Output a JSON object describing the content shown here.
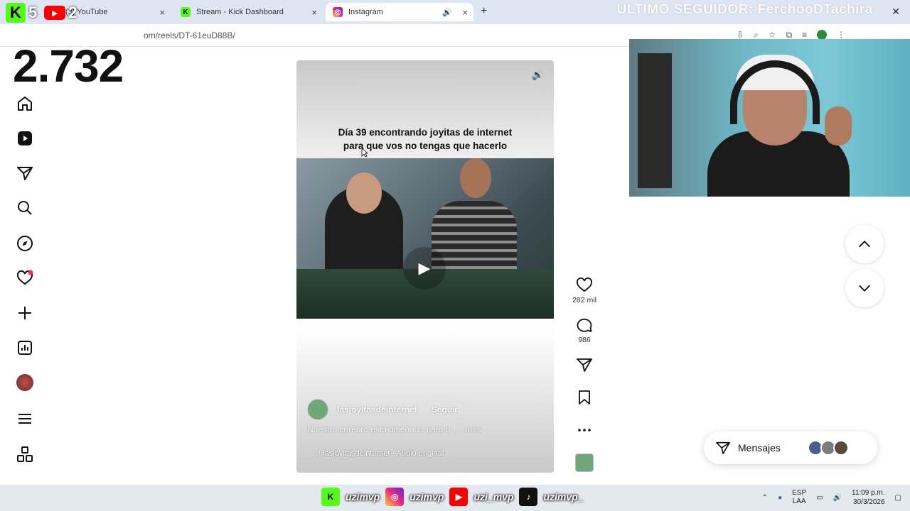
{
  "browser": {
    "tabs": [
      {
        "label": "(3) YouTube",
        "icon": "youtube-icon",
        "active": false
      },
      {
        "label": "Stream - Kick Dashboard",
        "icon": "kick-icon",
        "active": false
      },
      {
        "label": "Instagram",
        "icon": "instagram-icon",
        "active": true
      }
    ],
    "new_tab": "+",
    "url": "om/reels/DT-61euD88B/"
  },
  "stream_overlay": {
    "last_follower": "ULTIMO SEGUIDOR: FerchooDTachira",
    "kick_count": "5",
    "youtube_count": "2",
    "viewer_count": "2.732"
  },
  "sidebar": {
    "items": [
      {
        "name": "home",
        "icon": "home-icon"
      },
      {
        "name": "reels",
        "icon": "reels-icon"
      },
      {
        "name": "messages",
        "icon": "send-icon"
      },
      {
        "name": "search",
        "icon": "search-icon"
      },
      {
        "name": "explore",
        "icon": "compass-icon"
      },
      {
        "name": "notifications",
        "icon": "heart-icon"
      },
      {
        "name": "create",
        "icon": "plus-icon"
      },
      {
        "name": "dashboard",
        "icon": "chart-icon"
      },
      {
        "name": "profile",
        "icon": "avatar"
      },
      {
        "name": "more",
        "icon": "menu-icon"
      },
      {
        "name": "apps",
        "icon": "apps-icon"
      }
    ]
  },
  "reel": {
    "caption_line1": "Día 39 encontrando joyitas de internet",
    "caption_line2": "para que vos no tengas que hacerlo",
    "author": "lasjoyitasdeinternet",
    "follow_label": "Seguir",
    "description": "Nuestro cerebro está diseñado para b ...",
    "more_label": "más",
    "audio": "lasjoyitasdeinternet · Audio original"
  },
  "actions": {
    "likes": "282 mil",
    "comments": "986"
  },
  "messages_widget": {
    "label": "Mensajes"
  },
  "taskbar": {
    "names": [
      "uzimvp",
      "uzimvp",
      "uzi_mvp",
      "uzimvp_"
    ],
    "lang_line1": "ESP",
    "lang_line2": "LAA",
    "time": "11:09 p.m.",
    "date": "30/3/2026"
  },
  "colors": {
    "kick_green": "#53fc18",
    "youtube_red": "#ff0000",
    "notification_dot": "#ff3040"
  }
}
